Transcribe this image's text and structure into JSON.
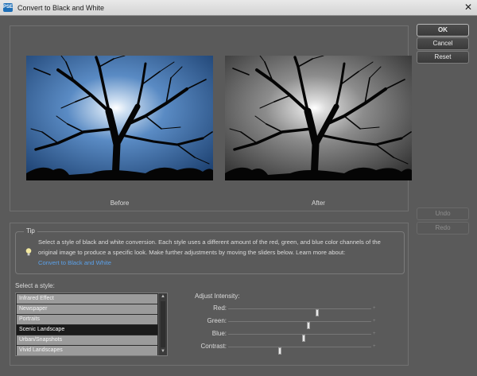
{
  "window": {
    "title": "Convert to Black and White",
    "close_glyph": "✕",
    "app_icon": "PSE"
  },
  "preview": {
    "before_caption": "Before",
    "after_caption": "After"
  },
  "buttons": {
    "ok": "OK",
    "cancel": "Cancel",
    "reset": "Reset",
    "undo": "Undo",
    "redo": "Redo"
  },
  "tip": {
    "legend": "Tip",
    "text": "Select a style of black and white conversion. Each style uses a different amount of the red, green, and blue color channels of the original image to produce a specific look. Make further adjustments by moving the sliders below. Learn more about:",
    "link": "Convert to Black and White"
  },
  "styles": {
    "label": "Select a style:",
    "items": [
      "Infrared Effect",
      "Newspaper",
      "Portraits",
      "Scenic Landscape",
      "Urban/Snapshots",
      "Vivid Landscapes"
    ],
    "selected": "Scenic Landscape"
  },
  "intensity": {
    "label": "Adjust Intensity:",
    "min_glyph": "-",
    "max_glyph": "+",
    "sliders": [
      {
        "name": "Red:",
        "value": 0.62
      },
      {
        "name": "Green:",
        "value": 0.56
      },
      {
        "name": "Blue:",
        "value": 0.53
      },
      {
        "name": "Contrast:",
        "value": 0.36
      }
    ]
  },
  "colors": {
    "accent_link": "#5ba0e8",
    "dialog_bg": "#5a5a5a",
    "sky_before": "#3d6fb0"
  }
}
